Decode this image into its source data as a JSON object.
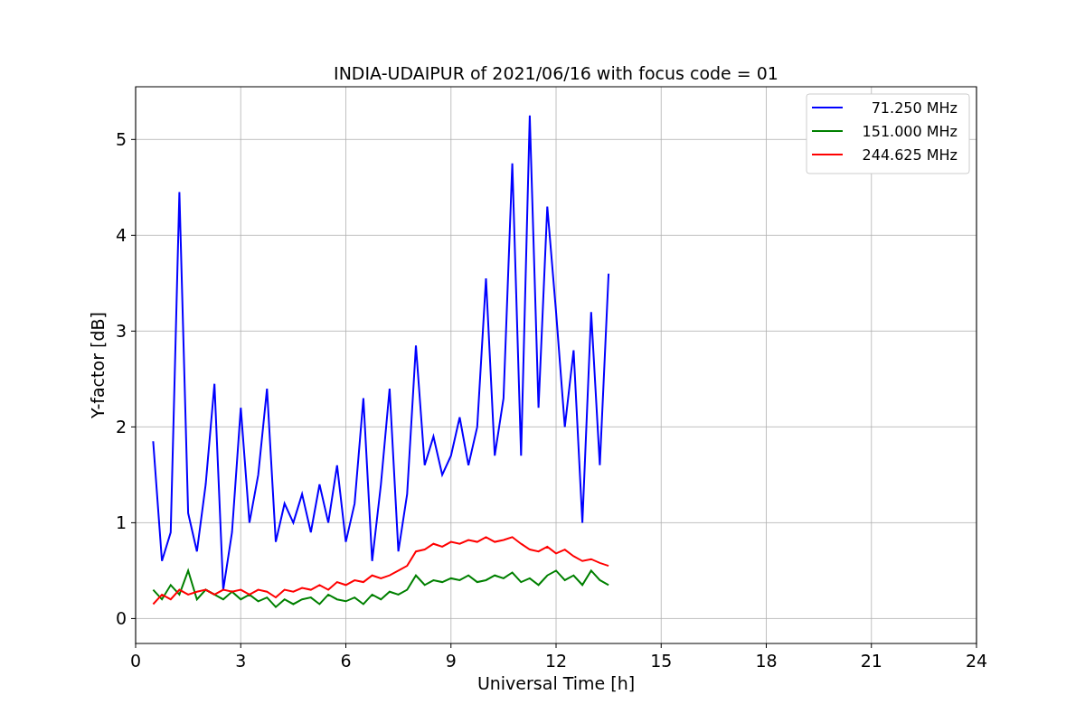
{
  "chart_data": {
    "type": "line",
    "title": "INDIA-UDAIPUR of 2021/06/16 with focus code = 01",
    "xlabel": "Universal Time [h]",
    "ylabel": "Y-factor [dB]",
    "x": [
      0.5,
      0.75,
      1,
      1.25,
      1.5,
      1.75,
      2,
      2.25,
      2.5,
      2.75,
      3,
      3.25,
      3.5,
      3.75,
      4,
      4.25,
      4.5,
      4.75,
      5,
      5.25,
      5.5,
      5.75,
      6,
      6.25,
      6.5,
      6.75,
      7,
      7.25,
      7.5,
      7.75,
      8,
      8.25,
      8.5,
      8.75,
      9,
      9.25,
      9.5,
      9.75,
      10,
      10.25,
      10.5,
      10.75,
      11,
      11.25,
      11.5,
      11.75,
      12,
      12.25,
      12.5,
      12.75,
      13,
      13.25,
      13.5
    ],
    "series": [
      {
        "name": "71.250 MHz",
        "color": "#0000ff",
        "values": [
          1.85,
          0.6,
          0.9,
          4.45,
          1.1,
          0.7,
          1.4,
          2.45,
          0.3,
          0.9,
          2.2,
          1.0,
          1.5,
          2.4,
          0.8,
          1.2,
          1.0,
          1.3,
          0.9,
          1.4,
          1.0,
          1.6,
          0.8,
          1.2,
          2.3,
          0.6,
          1.4,
          2.4,
          0.7,
          1.3,
          2.85,
          1.6,
          1.9,
          1.5,
          1.7,
          2.1,
          1.6,
          2.0,
          3.55,
          1.7,
          2.3,
          4.75,
          1.7,
          5.25,
          2.2,
          4.3,
          3.2,
          2.0,
          2.8,
          1.0,
          3.2,
          1.6,
          3.6
        ]
      },
      {
        "name": "151.000 MHz",
        "color": "#008000",
        "values": [
          0.3,
          0.2,
          0.35,
          0.25,
          0.5,
          0.2,
          0.3,
          0.25,
          0.2,
          0.28,
          0.2,
          0.25,
          0.18,
          0.22,
          0.12,
          0.2,
          0.15,
          0.2,
          0.22,
          0.15,
          0.25,
          0.2,
          0.18,
          0.22,
          0.15,
          0.25,
          0.2,
          0.28,
          0.25,
          0.3,
          0.45,
          0.35,
          0.4,
          0.38,
          0.42,
          0.4,
          0.45,
          0.38,
          0.4,
          0.45,
          0.42,
          0.48,
          0.38,
          0.42,
          0.35,
          0.45,
          0.5,
          0.4,
          0.45,
          0.35,
          0.5,
          0.4,
          0.35
        ]
      },
      {
        "name": "244.625 MHz",
        "color": "#ff0000",
        "values": [
          0.15,
          0.25,
          0.2,
          0.3,
          0.25,
          0.28,
          0.3,
          0.25,
          0.3,
          0.28,
          0.3,
          0.25,
          0.3,
          0.28,
          0.22,
          0.3,
          0.28,
          0.32,
          0.3,
          0.35,
          0.3,
          0.38,
          0.35,
          0.4,
          0.38,
          0.45,
          0.42,
          0.45,
          0.5,
          0.55,
          0.7,
          0.72,
          0.78,
          0.75,
          0.8,
          0.78,
          0.82,
          0.8,
          0.85,
          0.8,
          0.82,
          0.85,
          0.78,
          0.72,
          0.7,
          0.75,
          0.68,
          0.72,
          0.65,
          0.6,
          0.62,
          0.58,
          0.55
        ]
      }
    ],
    "grid": true,
    "legend": true,
    "xlim": [
      0,
      24
    ],
    "ylim": [
      -0.26,
      5.55
    ],
    "xticks": [
      0,
      3,
      6,
      9,
      12,
      15,
      18,
      21,
      24
    ],
    "yticks": [
      0,
      1,
      2,
      3,
      4,
      5
    ]
  }
}
